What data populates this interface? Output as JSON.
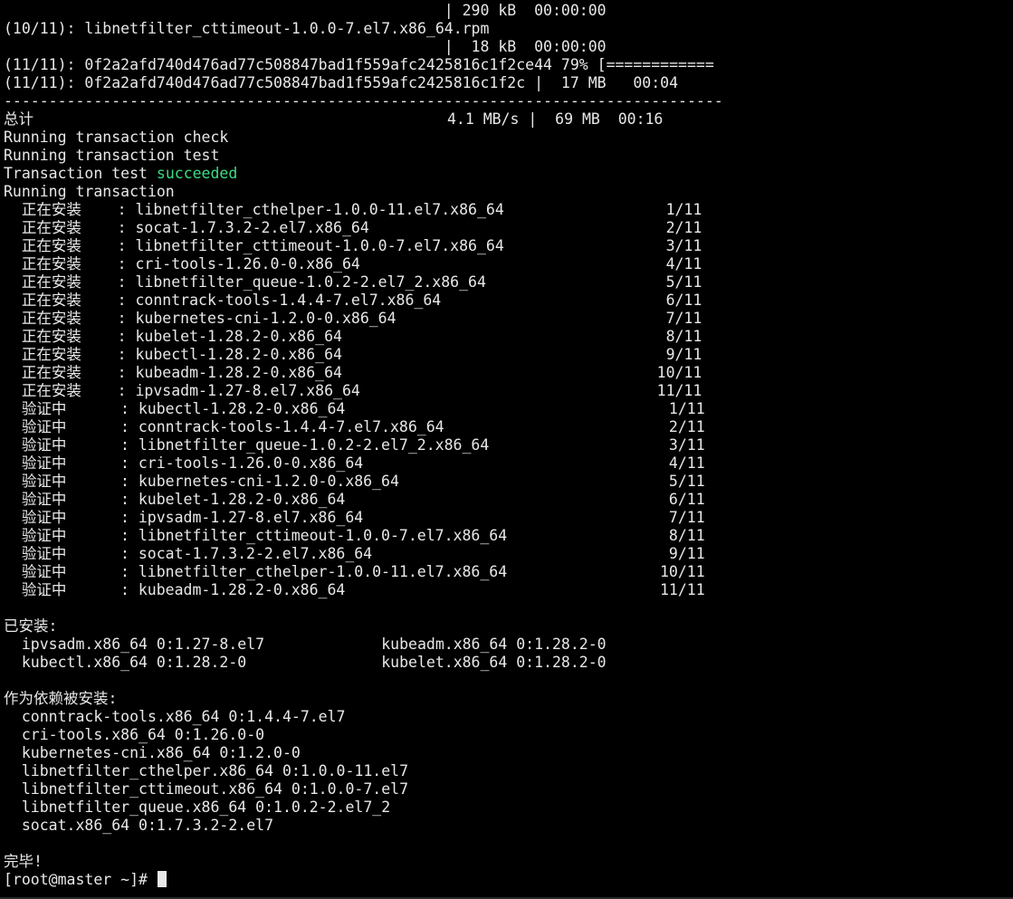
{
  "terminal": {
    "prompt": "[root@master ~]# ",
    "lines": [
      {
        "text": "                                                 | 290 kB  00:00:00"
      },
      {
        "text": "(10/11): libnetfilter_cttimeout-1.0.0-7.el7.x86_64.rpm"
      },
      {
        "text": "                                                 |  18 kB  00:00:00"
      },
      {
        "text": "(11/11): 0f2a2afd740d476ad77c508847bad1f559afc2425816c1f2ce44 79% [============"
      },
      {
        "text": "(11/11): 0f2a2afd740d476ad77c508847bad1f559afc2425816c1f2c |  17 MB   00:04"
      },
      {
        "text": "--------------------------------------------------------------------------------"
      },
      {
        "text": "总计                                              4.1 MB/s |  69 MB  00:16"
      },
      {
        "text": "Running transaction check"
      },
      {
        "text": "Running transaction test"
      },
      {
        "text": "Transaction test ",
        "status": "succeeded"
      },
      {
        "text": "Running transaction"
      },
      {
        "text": "  正在安装    : libnetfilter_cthelper-1.0.0-11.el7.x86_64                  1/11"
      },
      {
        "text": "  正在安装    : socat-1.7.3.2-2.el7.x86_64                                 2/11"
      },
      {
        "text": "  正在安装    : libnetfilter_cttimeout-1.0.0-7.el7.x86_64                  3/11"
      },
      {
        "text": "  正在安装    : cri-tools-1.26.0-0.x86_64                                  4/11"
      },
      {
        "text": "  正在安装    : libnetfilter_queue-1.0.2-2.el7_2.x86_64                    5/11"
      },
      {
        "text": "  正在安装    : conntrack-tools-1.4.4-7.el7.x86_64                         6/11"
      },
      {
        "text": "  正在安装    : kubernetes-cni-1.2.0-0.x86_64                              7/11"
      },
      {
        "text": "  正在安装    : kubelet-1.28.2-0.x86_64                                    8/11"
      },
      {
        "text": "  正在安装    : kubectl-1.28.2-0.x86_64                                    9/11"
      },
      {
        "text": "  正在安装    : kubeadm-1.28.2-0.x86_64                                   10/11"
      },
      {
        "text": "  正在安装    : ipvsadm-1.27-8.el7.x86_64                                 11/11"
      },
      {
        "text": "  验证中      : kubectl-1.28.2-0.x86_64                                    1/11"
      },
      {
        "text": "  验证中      : conntrack-tools-1.4.4-7.el7.x86_64                         2/11"
      },
      {
        "text": "  验证中      : libnetfilter_queue-1.0.2-2.el7_2.x86_64                    3/11"
      },
      {
        "text": "  验证中      : cri-tools-1.26.0-0.x86_64                                  4/11"
      },
      {
        "text": "  验证中      : kubernetes-cni-1.2.0-0.x86_64                              5/11"
      },
      {
        "text": "  验证中      : kubelet-1.28.2-0.x86_64                                    6/11"
      },
      {
        "text": "  验证中      : ipvsadm-1.27-8.el7.x86_64                                  7/11"
      },
      {
        "text": "  验证中      : libnetfilter_cttimeout-1.0.0-7.el7.x86_64                  8/11"
      },
      {
        "text": "  验证中      : socat-1.7.3.2-2.el7.x86_64                                 9/11"
      },
      {
        "text": "  验证中      : libnetfilter_cthelper-1.0.0-11.el7.x86_64                 10/11"
      },
      {
        "text": "  验证中      : kubeadm-1.28.2-0.x86_64                                   11/11"
      },
      {
        "text": ""
      },
      {
        "text": "已安装:"
      },
      {
        "text": "  ipvsadm.x86_64 0:1.27-8.el7             kubeadm.x86_64 0:1.28.2-0"
      },
      {
        "text": "  kubectl.x86_64 0:1.28.2-0               kubelet.x86_64 0:1.28.2-0"
      },
      {
        "text": ""
      },
      {
        "text": "作为依赖被安装:"
      },
      {
        "text": "  conntrack-tools.x86_64 0:1.4.4-7.el7"
      },
      {
        "text": "  cri-tools.x86_64 0:1.26.0-0"
      },
      {
        "text": "  kubernetes-cni.x86_64 0:1.2.0-0"
      },
      {
        "text": "  libnetfilter_cthelper.x86_64 0:1.0.0-11.el7"
      },
      {
        "text": "  libnetfilter_cttimeout.x86_64 0:1.0.0-7.el7"
      },
      {
        "text": "  libnetfilter_queue.x86_64 0:1.0.2-2.el7_2"
      },
      {
        "text": "  socat.x86_64 0:1.7.3.2-2.el7"
      },
      {
        "text": ""
      },
      {
        "text": "完毕!"
      }
    ],
    "colors": {
      "background": "#000000",
      "foreground": "#e8e8e8",
      "success": "#3ddc84"
    }
  }
}
